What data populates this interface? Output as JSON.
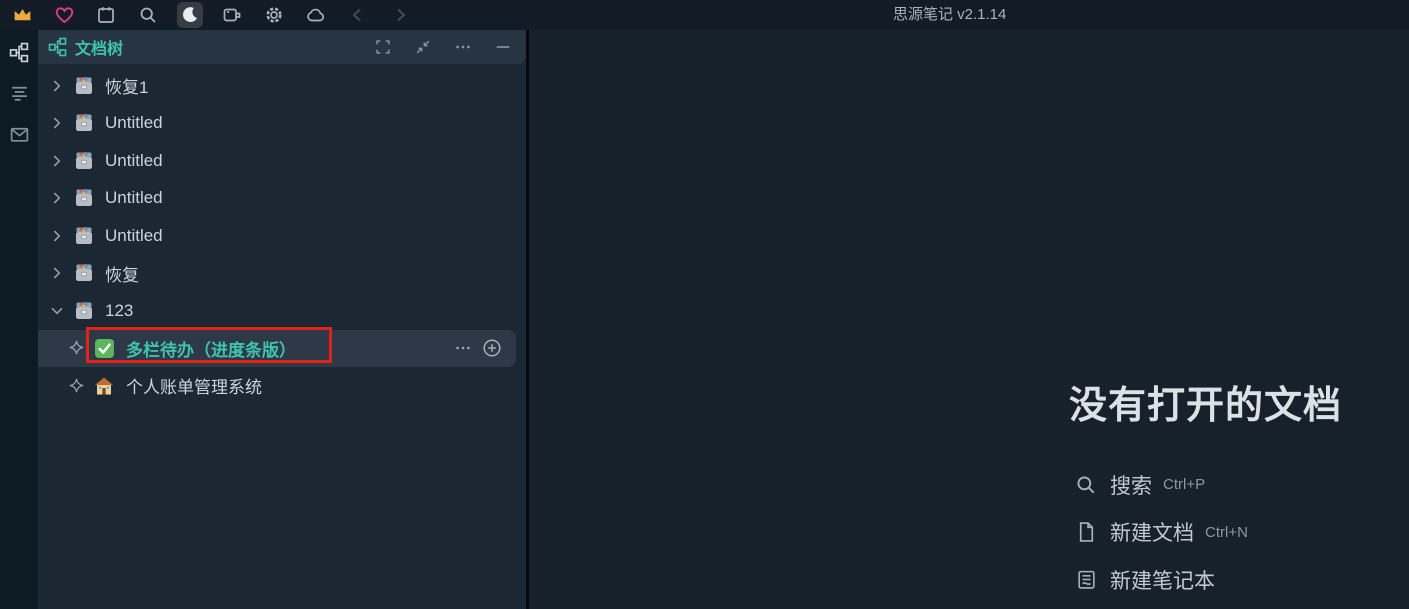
{
  "topbar": {
    "title": "思源笔记 v2.1.14",
    "buttons": [
      "crown",
      "heart",
      "calendar",
      "search",
      "dark-mode",
      "record",
      "settings",
      "sync-cloud",
      "back",
      "forward"
    ]
  },
  "dock": {
    "items": [
      "doc-tree",
      "outline",
      "inbox"
    ]
  },
  "panel": {
    "title": "文档树",
    "header_buttons": [
      "fullscreen",
      "collapse-panel",
      "more",
      "minimize"
    ]
  },
  "tree": {
    "items": [
      {
        "label": "恢复1",
        "type": "notebook",
        "expanded": false
      },
      {
        "label": "Untitled",
        "type": "notebook",
        "expanded": false
      },
      {
        "label": "Untitled",
        "type": "notebook",
        "expanded": false
      },
      {
        "label": "Untitled",
        "type": "notebook",
        "expanded": false
      },
      {
        "label": "Untitled",
        "type": "notebook",
        "expanded": false
      },
      {
        "label": "恢复",
        "type": "notebook",
        "expanded": false
      },
      {
        "label": "123",
        "type": "notebook",
        "expanded": true
      },
      {
        "label": "多栏待办（进度条版）",
        "type": "doc",
        "icon": "checkbox-emoji",
        "selected": true,
        "annotated": true
      },
      {
        "label": "个人账单管理系统",
        "type": "doc",
        "icon": "house-emoji",
        "selected": false
      }
    ]
  },
  "main": {
    "empty_title": "没有打开的文档",
    "actions": [
      {
        "label": "搜索",
        "shortcut": "Ctrl+P",
        "icon": "search"
      },
      {
        "label": "新建文档",
        "shortcut": "Ctrl+N",
        "icon": "new-file"
      },
      {
        "label": "新建笔记本",
        "shortcut": "",
        "icon": "new-notebook"
      }
    ]
  },
  "colors": {
    "accent_teal": "#3fc3ac",
    "annotation_red": "#e2221a",
    "selection_bg": "#2d3946",
    "topbar_bg": "#131c26",
    "panel_bg": "#1c2734",
    "main_bg": "#16212c",
    "crown_yellow": "#ecaa3b",
    "heart_pink": "#e23b8e"
  }
}
